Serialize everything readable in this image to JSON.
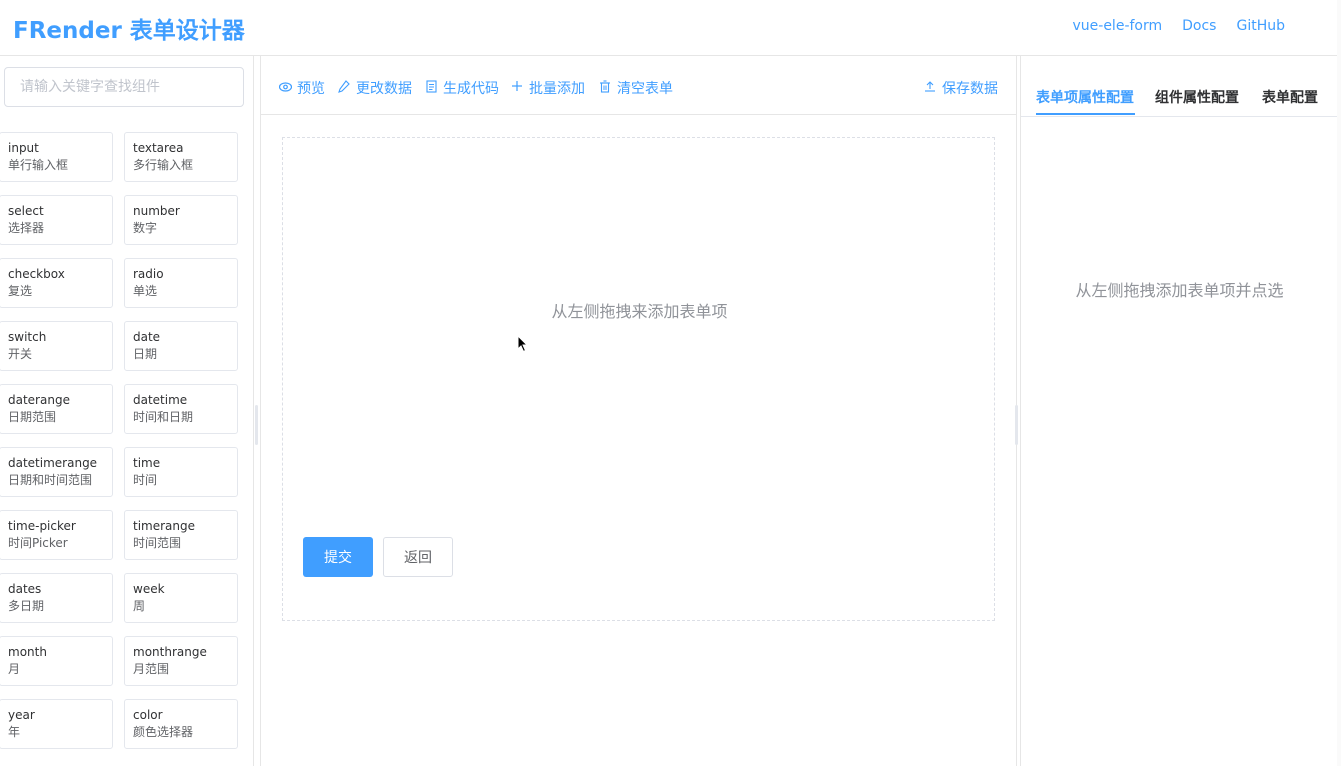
{
  "header": {
    "logo": "FRender 表单设计器",
    "links": [
      "vue-ele-form",
      "Docs",
      "GitHub"
    ]
  },
  "left": {
    "search_placeholder": "请输入关键字查找组件",
    "components": [
      {
        "en": "input",
        "zh": "单行输入框"
      },
      {
        "en": "textarea",
        "zh": "多行输入框"
      },
      {
        "en": "select",
        "zh": "选择器"
      },
      {
        "en": "number",
        "zh": "数字"
      },
      {
        "en": "checkbox",
        "zh": "复选"
      },
      {
        "en": "radio",
        "zh": "单选"
      },
      {
        "en": "switch",
        "zh": "开关"
      },
      {
        "en": "date",
        "zh": "日期"
      },
      {
        "en": "daterange",
        "zh": "日期范围"
      },
      {
        "en": "datetime",
        "zh": "时间和日期"
      },
      {
        "en": "datetimerange",
        "zh": "日期和时间范围"
      },
      {
        "en": "time",
        "zh": "时间"
      },
      {
        "en": "time-picker",
        "zh": "时间Picker"
      },
      {
        "en": "timerange",
        "zh": "时间范围"
      },
      {
        "en": "dates",
        "zh": "多日期"
      },
      {
        "en": "week",
        "zh": "周"
      },
      {
        "en": "month",
        "zh": "月"
      },
      {
        "en": "monthrange",
        "zh": "月范围"
      },
      {
        "en": "year",
        "zh": "年"
      },
      {
        "en": "color",
        "zh": "颜色选择器"
      }
    ]
  },
  "toolbar": {
    "preview": "预览",
    "edit_data": "更改数据",
    "gen_code": "生成代码",
    "batch_add": "批量添加",
    "clear": "清空表单",
    "save": "保存数据"
  },
  "canvas": {
    "empty_tip": "从左侧拖拽来添加表单项",
    "submit": "提交",
    "back": "返回"
  },
  "right": {
    "tabs": [
      "表单项属性配置",
      "组件属性配置",
      "表单配置"
    ],
    "tip": "从左侧拖拽添加表单项并点选"
  },
  "colors": {
    "accent": "#409eff",
    "border": "#dcdfe6",
    "muted": "#909399"
  }
}
